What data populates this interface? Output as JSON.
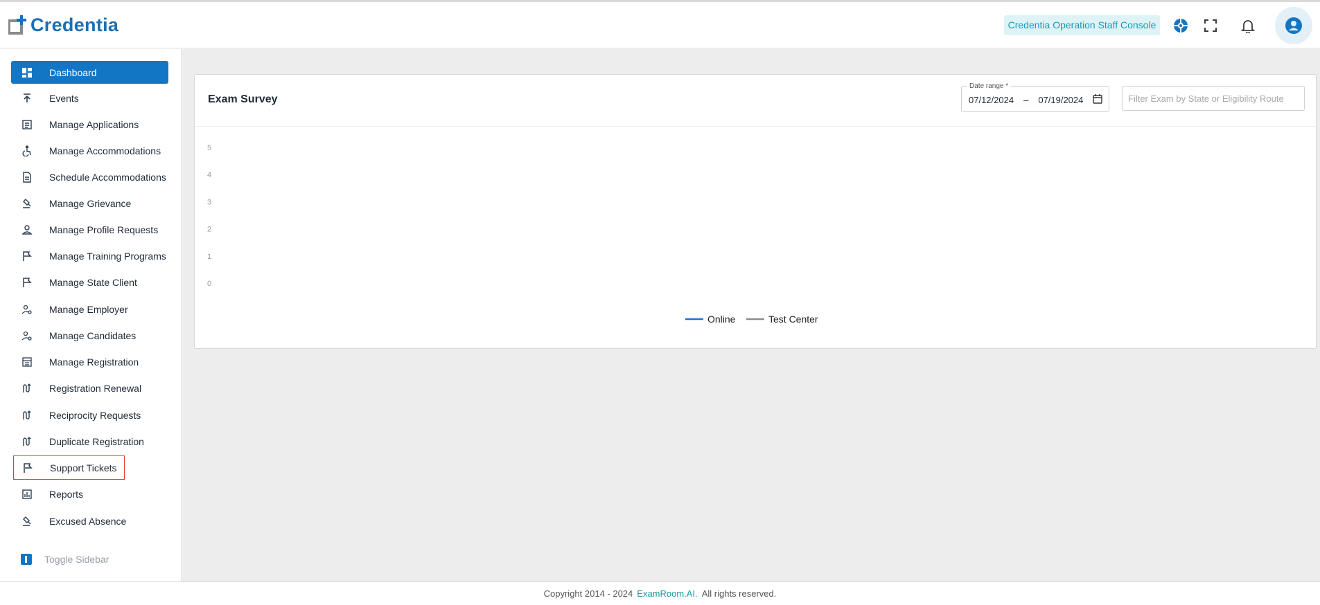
{
  "header": {
    "logo_text": "Credentia",
    "console_label": "Credentia Operation Staff Console",
    "icons": [
      "support-globe-icon",
      "fullscreen-icon",
      "bell-icon",
      "account-icon"
    ],
    "accent_color": "#1376c5"
  },
  "sidebar": {
    "items": [
      {
        "label": "Dashboard",
        "icon": "dashboard-icon"
      },
      {
        "label": "Events",
        "icon": "upload-arrow-icon"
      },
      {
        "label": "Manage Applications",
        "icon": "document-list-icon"
      },
      {
        "label": "Manage Accommodations",
        "icon": "accessibility-icon"
      },
      {
        "label": "Schedule Accommodations",
        "icon": "document-icon"
      },
      {
        "label": "Manage Grievance",
        "icon": "gavel-icon"
      },
      {
        "label": "Manage Profile Requests",
        "icon": "person-icon"
      },
      {
        "label": "Manage Training Programs",
        "icon": "flag-icon"
      },
      {
        "label": "Manage State Client",
        "icon": "flag-icon"
      },
      {
        "label": "Manage Employer",
        "icon": "person-gear-icon"
      },
      {
        "label": "Manage Candidates",
        "icon": "person-gear-icon"
      },
      {
        "label": "Manage Registration",
        "icon": "calendar-grid-icon"
      },
      {
        "label": "Registration Renewal",
        "icon": "route-icon"
      },
      {
        "label": "Reciprocity Requests",
        "icon": "route-icon"
      },
      {
        "label": "Duplicate Registration",
        "icon": "route-icon"
      },
      {
        "label": "Support Tickets",
        "icon": "flag-icon"
      },
      {
        "label": "Reports",
        "icon": "bar-chart-icon"
      },
      {
        "label": "Excused Absence",
        "icon": "gavel-icon"
      }
    ],
    "toggle_label": "Toggle Sidebar"
  },
  "main": {
    "card_title": "Exam Survey",
    "date_range": {
      "label": "Date range *",
      "start": "07/12/2024",
      "separator": "–",
      "end": "07/19/2024"
    },
    "filter_placeholder": "Filter Exam by State or Eligibility Route"
  },
  "chart_data": {
    "type": "line",
    "title": "",
    "xlabel": "",
    "ylabel": "",
    "y_ticks": [
      "0",
      "1",
      "2",
      "3",
      "4",
      "5"
    ],
    "ylim": [
      0,
      5
    ],
    "series": [
      {
        "name": "Online",
        "color": "#1976d2",
        "values": []
      },
      {
        "name": "Test Center",
        "color": "#8c8c8c",
        "values": []
      }
    ],
    "legend": "bottom-center",
    "grid": false
  },
  "footer": {
    "copyright": "Copyright 2014 - 2024",
    "brand": "ExamRoom.AI.",
    "rights": "All rights reserved."
  }
}
